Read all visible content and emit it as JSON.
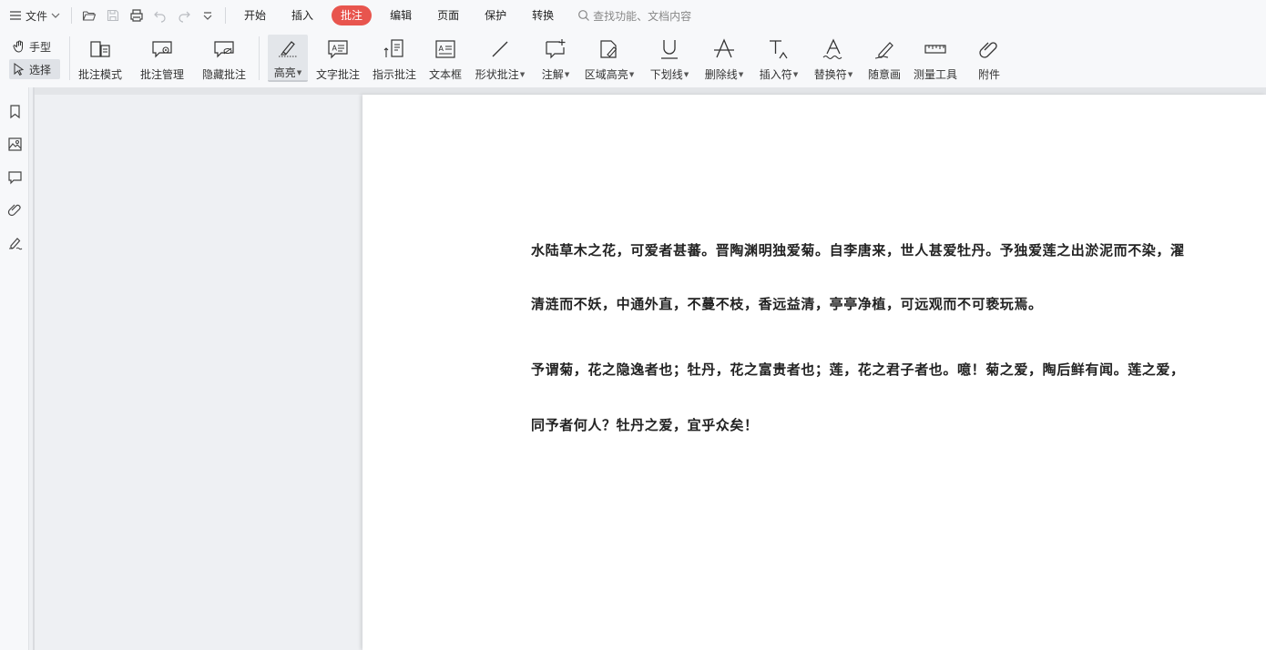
{
  "menubar": {
    "file_label": "文件",
    "tabs": [
      "开始",
      "插入",
      "批注",
      "编辑",
      "页面",
      "保护",
      "转换"
    ],
    "active_tab": "批注",
    "search_placeholder": "查找功能、文档内容"
  },
  "ribbon": {
    "modes": [
      "手型",
      "选择"
    ],
    "active_mode": "选择",
    "tools": [
      {
        "id": "annotation-mode",
        "label": "批注模式",
        "dropdown": false
      },
      {
        "id": "annotation-manage",
        "label": "批注管理",
        "dropdown": false
      },
      {
        "id": "hide-annotation",
        "label": "隐藏批注",
        "dropdown": false
      },
      {
        "id": "highlight",
        "label": "高亮",
        "dropdown": true
      },
      {
        "id": "text-annotation",
        "label": "文字批注",
        "dropdown": false
      },
      {
        "id": "pointer-annotation",
        "label": "指示批注",
        "dropdown": false
      },
      {
        "id": "text-box",
        "label": "文本框",
        "dropdown": false
      },
      {
        "id": "shape-annotation",
        "label": "形状批注",
        "dropdown": true
      },
      {
        "id": "note",
        "label": "注解",
        "dropdown": true
      },
      {
        "id": "area-highlight",
        "label": "区域高亮",
        "dropdown": true
      },
      {
        "id": "underline",
        "label": "下划线",
        "dropdown": true
      },
      {
        "id": "strikethrough",
        "label": "删除线",
        "dropdown": true
      },
      {
        "id": "insert-mark",
        "label": "插入符",
        "dropdown": true
      },
      {
        "id": "replace-mark",
        "label": "替换符",
        "dropdown": true
      },
      {
        "id": "freehand",
        "label": "随意画",
        "dropdown": false
      },
      {
        "id": "measure",
        "label": "测量工具",
        "dropdown": false
      },
      {
        "id": "attachment",
        "label": "附件",
        "dropdown": false
      }
    ],
    "active_tool": "高亮"
  },
  "sidebar": {
    "icons": [
      "bookmark-icon",
      "image-icon",
      "comment-icon",
      "attachment-icon",
      "signature-icon"
    ]
  },
  "document": {
    "lines": [
      "水陆草木之花，可爱者甚蕃。晋陶渊明独爱菊。自李唐来，世人甚爱牡丹。予独爱莲之出淤泥而不染，濯",
      "清涟而不妖，中通外直，不蔓不枝，香远益清，亭亭净植，可远观而不可亵玩焉。",
      "予谓菊，花之隐逸者也；牡丹，花之富贵者也；莲，花之君子者也。噫！菊之爱，陶后鲜有闻。莲之爱，",
      "同予者何人？牡丹之爱，宜乎众矣！"
    ]
  },
  "colors": {
    "accent": "#e8554e",
    "toolbar_bg": "#f7f8fa",
    "workspace_bg": "#eef0f3",
    "page_bg": "#ffffff"
  }
}
